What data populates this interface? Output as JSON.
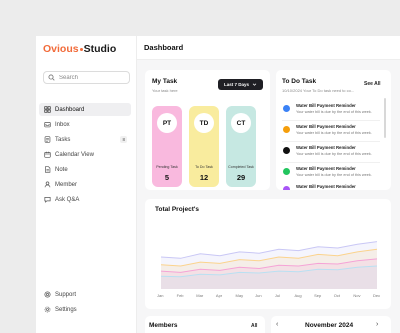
{
  "brand": {
    "part1": "Ovious",
    "part2": "Studio",
    "accent": "#f26b3a"
  },
  "search": {
    "placeholder": "Search"
  },
  "nav": {
    "items": [
      {
        "label": "Dashboard",
        "icon": "grid-icon",
        "active": true
      },
      {
        "label": "Inbox",
        "icon": "inbox-icon"
      },
      {
        "label": "Tasks",
        "icon": "tasks-icon",
        "badge": "8"
      },
      {
        "label": "Calendar View",
        "icon": "calendar-icon"
      },
      {
        "label": "Note",
        "icon": "note-icon"
      },
      {
        "label": "Member",
        "icon": "member-icon"
      },
      {
        "label": "Ask Q&A",
        "icon": "chat-icon"
      }
    ],
    "bottom": [
      {
        "label": "Support",
        "icon": "support-icon"
      },
      {
        "label": "Settings",
        "icon": "gear-icon"
      }
    ]
  },
  "header": {
    "title": "Dashboard"
  },
  "my_task": {
    "title": "My Task",
    "subtitle": "Your task here",
    "range": "Last 7 Days",
    "stats": [
      {
        "initials": "PT",
        "label": "Pending Task",
        "value": "5",
        "color": "#f9b9de"
      },
      {
        "initials": "TD",
        "label": "To Do Task",
        "value": "12",
        "color": "#f9ec9e"
      },
      {
        "initials": "CT",
        "label": "Completed Task",
        "value": "29",
        "color": "#c6e8e2"
      }
    ]
  },
  "todo": {
    "title": "To Do Task",
    "date_line": "10/10/2024 Your To Do task need to co...",
    "see_all": "See All",
    "items": [
      {
        "title": "Water Bill Payment Reminder",
        "desc": "Your water bill is due by the end of this week.",
        "color": "#3b82f6"
      },
      {
        "title": "Water Bill Payment Reminder",
        "desc": "Your water bill is due by the end of this week.",
        "color": "#f59e0b"
      },
      {
        "title": "Water Bill Payment Reminder",
        "desc": "Your water bill is due by the end of this week.",
        "color": "#111111"
      },
      {
        "title": "Water Bill Payment Reminder",
        "desc": "Your water bill is due by the end of this week.",
        "color": "#22c55e"
      },
      {
        "title": "Water Bill Payment Reminder",
        "desc": "Your water bill is due by the end of this week.",
        "color": "#a855f7"
      }
    ]
  },
  "projects": {
    "title": "Total Project's"
  },
  "chart_data": {
    "type": "area",
    "title": "Total Project's",
    "categories": [
      "Jan",
      "Feb",
      "Mar",
      "Apr",
      "May",
      "Jun",
      "Jul",
      "Aug",
      "Sep",
      "Oct",
      "Nov",
      "Dec"
    ],
    "series": [
      {
        "color": "#c9c7f5",
        "values": [
          50,
          48,
          55,
          52,
          58,
          56,
          62,
          60,
          66,
          64,
          70,
          74
        ]
      },
      {
        "color": "#fbd38d",
        "values": [
          38,
          36,
          42,
          40,
          46,
          44,
          50,
          48,
          54,
          52,
          58,
          62
        ]
      },
      {
        "color": "#f5a3d6",
        "values": [
          28,
          26,
          31,
          29,
          34,
          32,
          37,
          36,
          40,
          39,
          44,
          47
        ]
      },
      {
        "color": "#b9e0f2",
        "values": [
          20,
          19,
          23,
          22,
          26,
          25,
          28,
          27,
          31,
          30,
          34,
          36
        ]
      }
    ],
    "ylim": [
      0,
      100
    ],
    "grid": false,
    "legend": "none"
  },
  "members": {
    "title": "Members",
    "link": "All"
  },
  "calendar": {
    "month": "November 2024"
  }
}
